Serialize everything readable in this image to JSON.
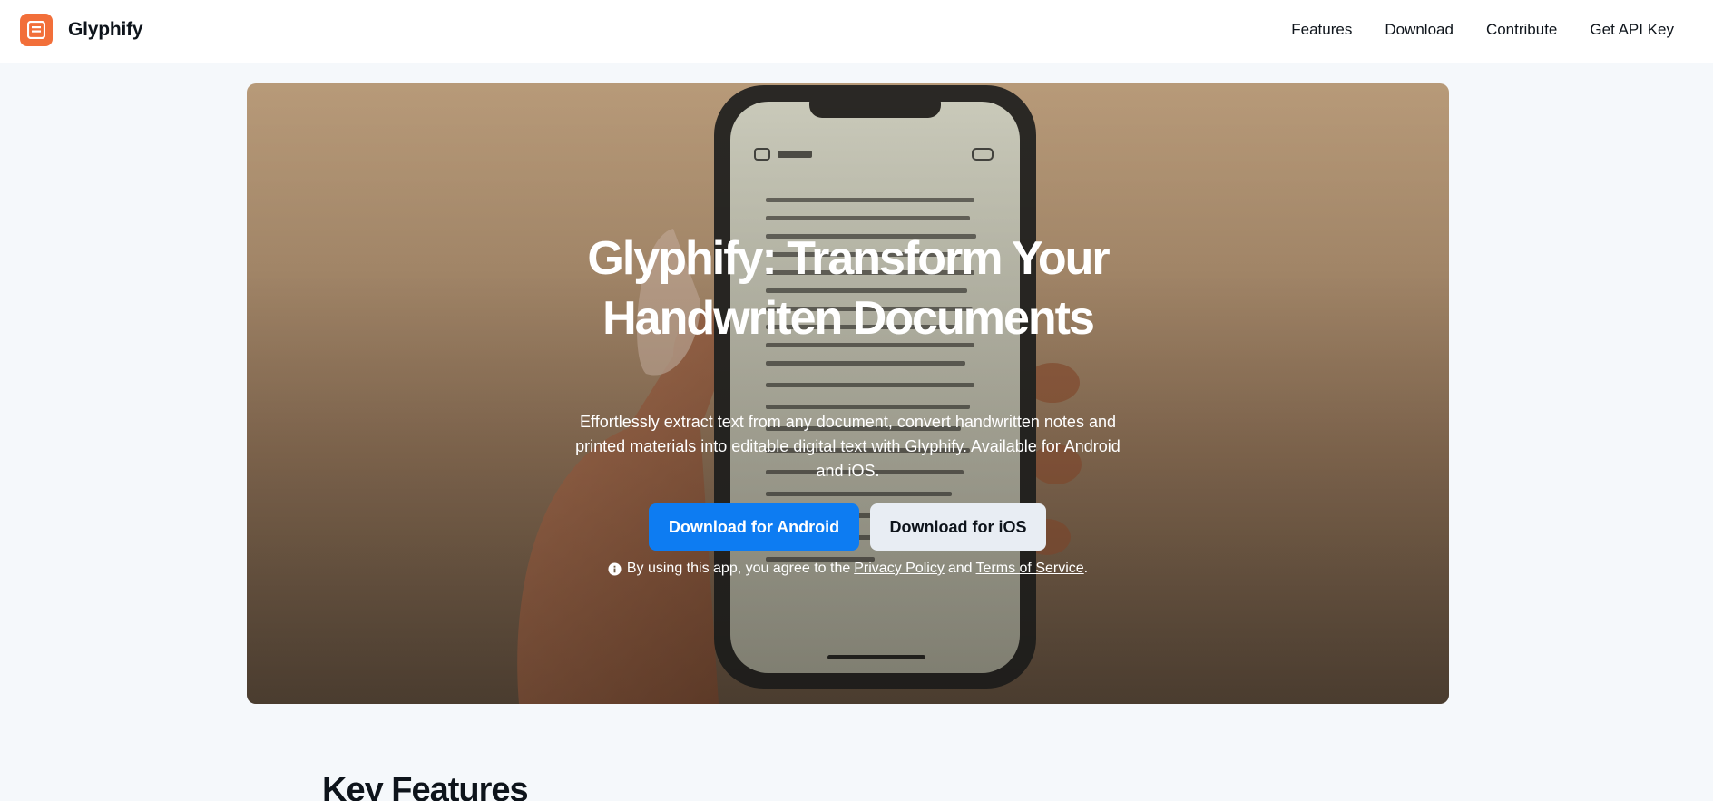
{
  "header": {
    "brand_name": "Glyphify",
    "logo_icon": "document-icon",
    "accent_color": "#f26f3a",
    "nav": [
      {
        "label": "Features"
      },
      {
        "label": "Download"
      },
      {
        "label": "Contribute"
      },
      {
        "label": "Get API Key"
      }
    ]
  },
  "hero": {
    "title_line1": "Glyphify: Transform Your",
    "title_line2": "Handwriten Documents",
    "subtitle": "Effortlessly extract text from any document, convert handwritten notes and printed materials into editable digital text with Glyphify. Available for Android and iOS.",
    "android_button": "Download for Android",
    "ios_button": "Download for iOS",
    "android_color": "#0d7cf2",
    "terms_prefix": "By using this app, you agree to the",
    "privacy_link": "Privacy Policy",
    "terms_and": "and",
    "terms_link": "Terms of Service",
    "terms_suffix": "."
  },
  "features": {
    "title": "Key Features"
  }
}
